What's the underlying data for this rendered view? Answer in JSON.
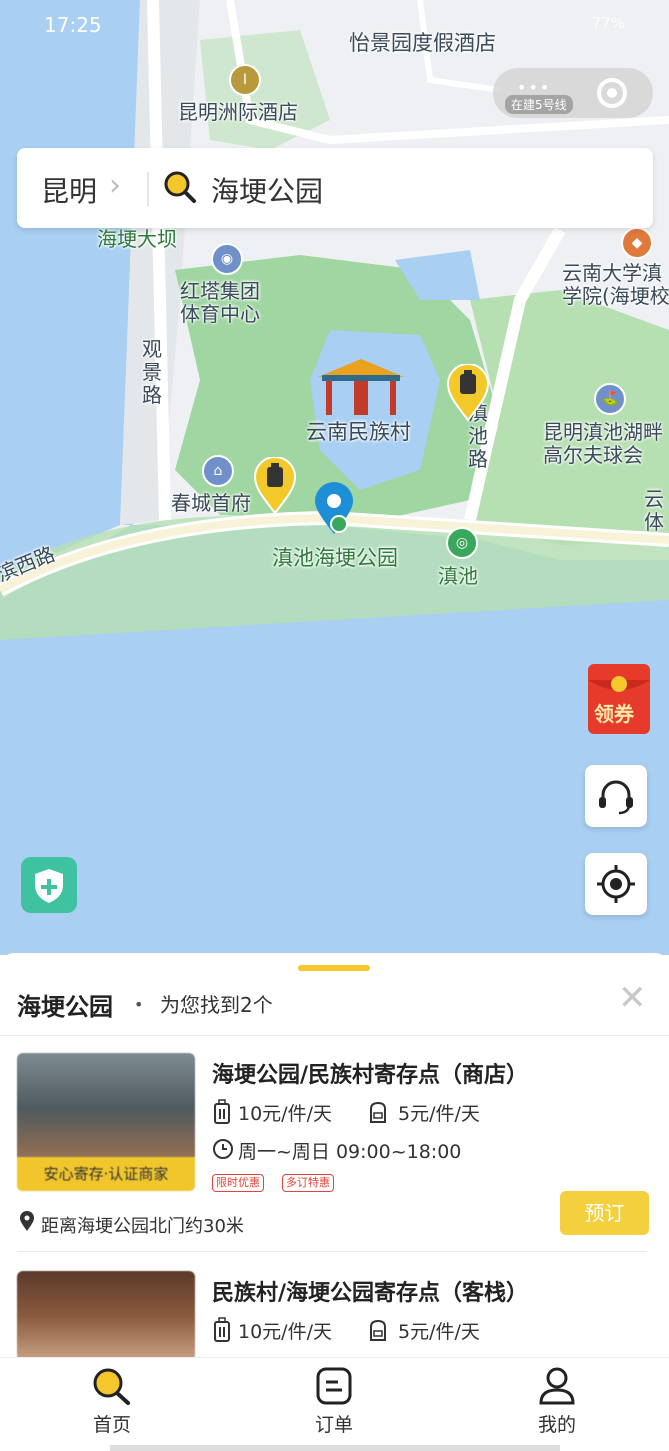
{
  "status": {
    "time": "17:25",
    "battery": "77%"
  },
  "mini_program": {
    "chip": "在建5号线"
  },
  "search": {
    "city": "昆明",
    "query": "海埂公园"
  },
  "map_labels": {
    "hotel_resort": "怡景园度假酒店",
    "hotel_intl": "昆明洲际酒店",
    "dam": "海埂大坝",
    "gym": "红塔集团\n体育中心",
    "guanjing_road": "观\n景\n路",
    "yunnan_univ": "云南大学滇\n学院(海埂校",
    "dianchi_road": "滇\n池\n路",
    "minzu_village": "云南民族村",
    "golf": "昆明滇池湖畔\n高尔夫球会",
    "chuncheng": "春城首府",
    "haigeng_park": "滇池海埂公园",
    "dianchi": "滇池",
    "west_road": "滨西路",
    "edge_right": "云\n体"
  },
  "coupon_label": "领券",
  "sheet": {
    "title": "海埂公园",
    "dot": "•",
    "found_text": "为您找到2个",
    "close": "✕"
  },
  "results": [
    {
      "name": "海埂公园/民族村寄存点（商店）",
      "price_large": "10元/件/天",
      "price_small": "5元/件/天",
      "hours": "周一~周日 09:00~18:00",
      "tags": [
        "限时优惠",
        "多订特惠"
      ],
      "badge": "安心寄存·认证商家",
      "distance": "距离海埂公园北门约30米",
      "book": "预订"
    },
    {
      "name": "民族村/海埂公园寄存点（客栈）",
      "price_large": "10元/件/天",
      "price_small": "5元/件/天"
    }
  ],
  "tabs": [
    {
      "label": "首页",
      "icon": "search-icon"
    },
    {
      "label": "订单",
      "icon": "order-icon"
    },
    {
      "label": "我的",
      "icon": "profile-icon"
    }
  ],
  "colors": {
    "accent": "#f5c72c",
    "water": "#a9cff3",
    "park": "#9fd6a1",
    "shield": "#3fc2a0"
  }
}
